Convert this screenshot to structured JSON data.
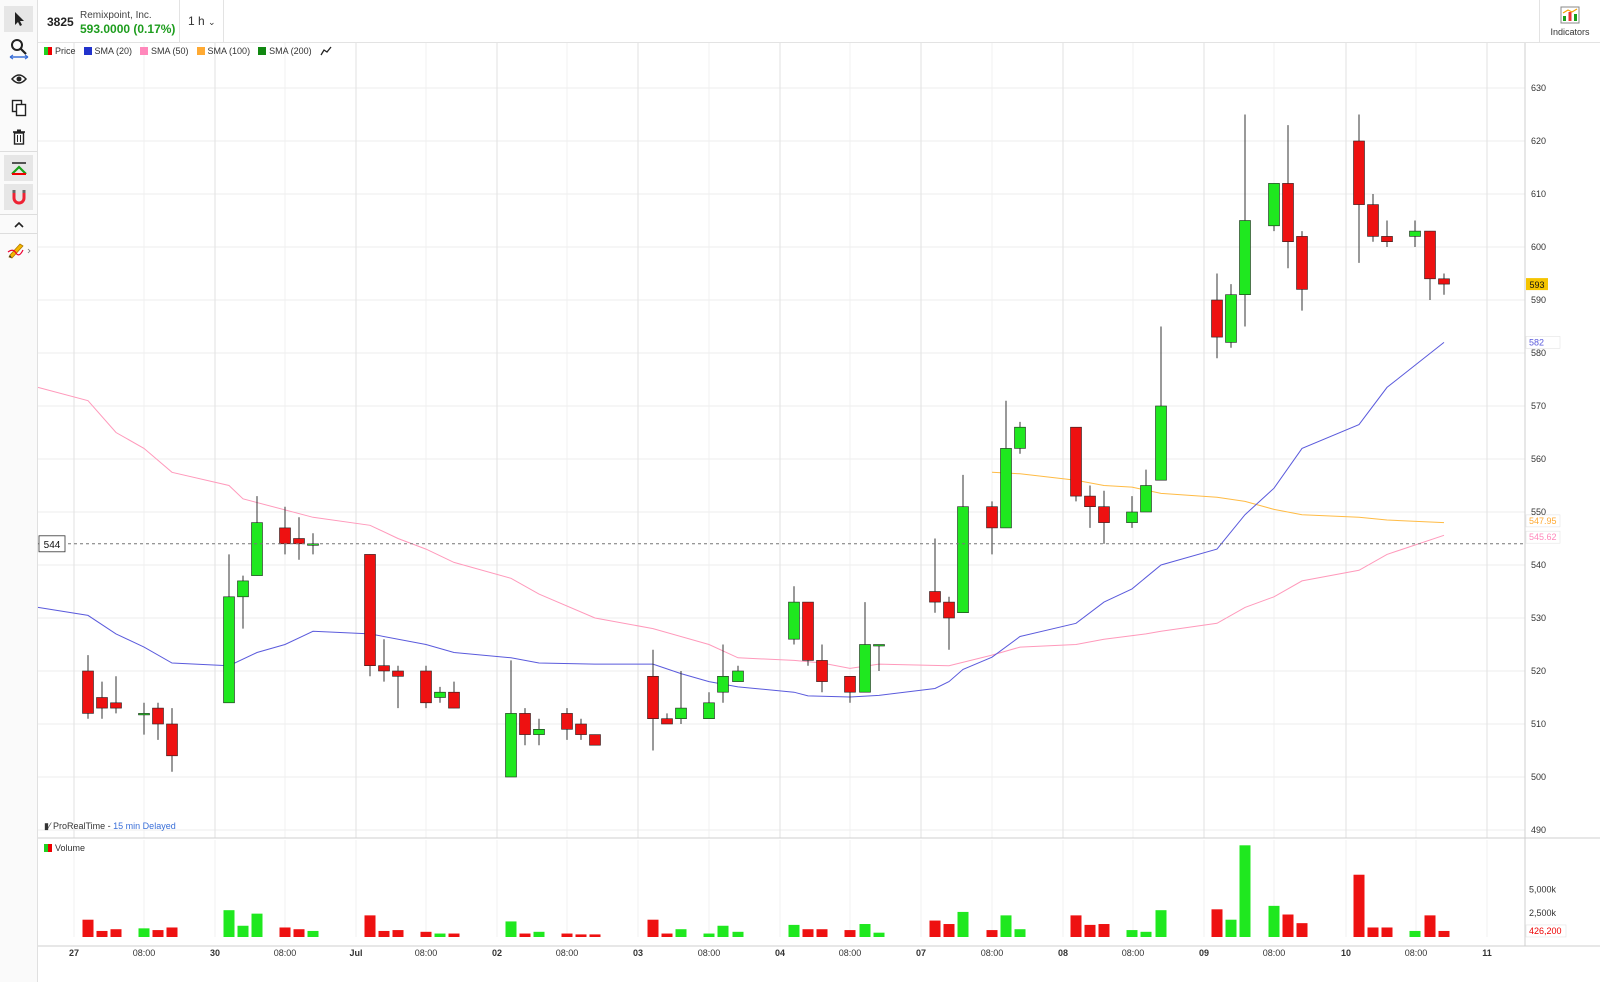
{
  "header": {
    "symbol": "3825",
    "company": "Remixpoint, Inc.",
    "price": "593.0000 (0.17%)",
    "timeframe": "1 h",
    "indicators_label": "Indicators"
  },
  "toolbar": {
    "icons": [
      "pointer-icon",
      "zoom-icon",
      "eye-icon",
      "copy-icon",
      "trash-icon",
      "trend-icon",
      "magnet-icon",
      "chevron-up-icon",
      "pencil-icon"
    ]
  },
  "legend": [
    {
      "label": "Price",
      "color": "#1fd11f"
    },
    {
      "label": "SMA (20)",
      "color": "#2233cc"
    },
    {
      "label": "SMA (50)",
      "color": "#ff88bb"
    },
    {
      "label": "SMA (100)",
      "color": "#ffaa33"
    },
    {
      "label": "SMA (200)",
      "color": "#118811"
    }
  ],
  "footer": {
    "source": "ProRealTime",
    "delay": "15 min Delayed"
  },
  "volume_label": "Volume",
  "crosshair_label": "544",
  "colors": {
    "up": "#1fe81f",
    "down": "#ee1111",
    "sma20": "#5a5adc",
    "sma50": "#ff99bb",
    "sma100": "#ffbb44"
  },
  "chart_data": {
    "type": "candlestick",
    "price_axis": {
      "ticks": [
        490,
        500,
        510,
        520,
        530,
        540,
        550,
        560,
        570,
        580,
        590,
        600,
        610,
        620,
        630
      ]
    },
    "volume_axis": {
      "ticks": [
        "2,500k",
        "5,000k"
      ]
    },
    "time_axis": {
      "labels": [
        "27",
        "08:00",
        "30",
        "08:00",
        "Jul",
        "08:00",
        "02",
        "08:00",
        "03",
        "08:00",
        "04",
        "08:00",
        "07",
        "08:00",
        "08",
        "08:00",
        "09",
        "08:00",
        "10",
        "08:00",
        "11"
      ]
    },
    "current_price_label": "593",
    "sma_labels": [
      {
        "text": "582",
        "color": "#5a5adc"
      },
      {
        "text": "547.95",
        "color": "#ffaa33"
      },
      {
        "text": "545.62",
        "color": "#ff88bb"
      }
    ],
    "volume_last_label": "426,200",
    "candles": [
      [
        88,
        520,
        512,
        523,
        511
      ],
      [
        102,
        515,
        513,
        518,
        511
      ],
      [
        116,
        514,
        513,
        519,
        512
      ],
      [
        144,
        512,
        512,
        514,
        508
      ],
      [
        158,
        513,
        510,
        514,
        507
      ],
      [
        172,
        510,
        504,
        513,
        501
      ],
      [
        229,
        514,
        534,
        542,
        514
      ],
      [
        243,
        534,
        537,
        538,
        528
      ],
      [
        257,
        538,
        548,
        553,
        538
      ],
      [
        285,
        547,
        544,
        551,
        542
      ],
      [
        299,
        545,
        544,
        549,
        541
      ],
      [
        313,
        544,
        544,
        546,
        542
      ],
      [
        370,
        542,
        521,
        542,
        519
      ],
      [
        384,
        521,
        520,
        526,
        518
      ],
      [
        398,
        520,
        519,
        521,
        513
      ],
      [
        426,
        520,
        514,
        521,
        513
      ],
      [
        440,
        515,
        516,
        517,
        514
      ],
      [
        454,
        516,
        513,
        518,
        513
      ],
      [
        511,
        500,
        512,
        522,
        500
      ],
      [
        525,
        512,
        508,
        513,
        506
      ],
      [
        539,
        508,
        509,
        511,
        506
      ],
      [
        567,
        512,
        509,
        513,
        507
      ],
      [
        581,
        510,
        508,
        511,
        507
      ],
      [
        595,
        508,
        506,
        508,
        506
      ],
      [
        653,
        519,
        511,
        524,
        505
      ],
      [
        667,
        511,
        510,
        512,
        510
      ],
      [
        681,
        511,
        513,
        520,
        510
      ],
      [
        709,
        511,
        514,
        516,
        512
      ],
      [
        723,
        516,
        519,
        525,
        514
      ],
      [
        738,
        518,
        520,
        521,
        518
      ],
      [
        794,
        526,
        533,
        536,
        525
      ],
      [
        808,
        533,
        522,
        533,
        521
      ],
      [
        822,
        522,
        518,
        525,
        516
      ],
      [
        850,
        519,
        516,
        519,
        514
      ],
      [
        865,
        516,
        525,
        533,
        516
      ],
      [
        879,
        525,
        525,
        525,
        520
      ],
      [
        935,
        535,
        533,
        545,
        531
      ],
      [
        949,
        533,
        530,
        534,
        524
      ],
      [
        963,
        531,
        551,
        557,
        531
      ],
      [
        992,
        551,
        547,
        552,
        542
      ],
      [
        1006,
        547,
        562,
        571,
        547
      ],
      [
        1020,
        562,
        566,
        567,
        561
      ],
      [
        1076,
        566,
        553,
        566,
        552
      ],
      [
        1090,
        553,
        551,
        555,
        547
      ],
      [
        1104,
        551,
        548,
        554,
        544
      ],
      [
        1132,
        548,
        550,
        553,
        547
      ],
      [
        1146,
        550,
        555,
        558,
        550
      ],
      [
        1161,
        556,
        570,
        585,
        556
      ],
      [
        1217,
        590,
        583,
        595,
        579
      ],
      [
        1231,
        582,
        591,
        593,
        581
      ],
      [
        1245,
        591,
        605,
        625,
        585
      ],
      [
        1274,
        604,
        612,
        612,
        603
      ],
      [
        1288,
        612,
        601,
        623,
        596
      ],
      [
        1302,
        602,
        592,
        603,
        588
      ],
      [
        1359,
        620,
        608,
        625,
        597
      ],
      [
        1373,
        608,
        602,
        610,
        601
      ],
      [
        1387,
        602,
        601,
        605,
        600
      ],
      [
        1415,
        602,
        603,
        605,
        600
      ],
      [
        1430,
        603,
        594,
        603,
        590
      ],
      [
        1444,
        594,
        593,
        595,
        591
      ]
    ],
    "volumes": [
      [
        88,
        1.0
      ],
      [
        102,
        0.35
      ],
      [
        116,
        0.45
      ],
      [
        144,
        0.5
      ],
      [
        158,
        0.4
      ],
      [
        172,
        0.55
      ],
      [
        229,
        1.55
      ],
      [
        243,
        0.65
      ],
      [
        257,
        1.35
      ],
      [
        285,
        0.55
      ],
      [
        299,
        0.45
      ],
      [
        313,
        0.35
      ],
      [
        370,
        1.25
      ],
      [
        384,
        0.35
      ],
      [
        398,
        0.4
      ],
      [
        426,
        0.3
      ],
      [
        440,
        0.2
      ],
      [
        454,
        0.2
      ],
      [
        511,
        0.9
      ],
      [
        525,
        0.2
      ],
      [
        539,
        0.3
      ],
      [
        567,
        0.2
      ],
      [
        581,
        0.15
      ],
      [
        595,
        0.15
      ],
      [
        653,
        1.0
      ],
      [
        667,
        0.2
      ],
      [
        681,
        0.45
      ],
      [
        709,
        0.2
      ],
      [
        723,
        0.65
      ],
      [
        738,
        0.3
      ],
      [
        794,
        0.7
      ],
      [
        808,
        0.45
      ],
      [
        822,
        0.45
      ],
      [
        850,
        0.4
      ],
      [
        865,
        0.75
      ],
      [
        879,
        0.25
      ],
      [
        935,
        0.95
      ],
      [
        949,
        0.75
      ],
      [
        963,
        1.45
      ],
      [
        992,
        0.4
      ],
      [
        1006,
        1.25
      ],
      [
        1020,
        0.45
      ],
      [
        1076,
        1.25
      ],
      [
        1090,
        0.7
      ],
      [
        1104,
        0.75
      ],
      [
        1132,
        0.4
      ],
      [
        1146,
        0.3
      ],
      [
        1161,
        1.55
      ],
      [
        1217,
        1.6
      ],
      [
        1231,
        1.0
      ],
      [
        1245,
        5.3
      ],
      [
        1274,
        1.8
      ],
      [
        1288,
        1.3
      ],
      [
        1302,
        0.8
      ],
      [
        1359,
        3.6
      ],
      [
        1373,
        0.55
      ],
      [
        1387,
        0.55
      ],
      [
        1415,
        0.35
      ],
      [
        1430,
        1.25
      ],
      [
        1444,
        0.35
      ]
    ],
    "sma20": [
      [
        38,
        532
      ],
      [
        88,
        530.5
      ],
      [
        116,
        527
      ],
      [
        144,
        524.5
      ],
      [
        172,
        521.5
      ],
      [
        229,
        521
      ],
      [
        257,
        523.5
      ],
      [
        285,
        525
      ],
      [
        313,
        527.5
      ],
      [
        370,
        527
      ],
      [
        426,
        525
      ],
      [
        454,
        523.5
      ],
      [
        511,
        522.5
      ],
      [
        539,
        521.5
      ],
      [
        595,
        521.3
      ],
      [
        653,
        521.3
      ],
      [
        681,
        519.5
      ],
      [
        709,
        518
      ],
      [
        738,
        517
      ],
      [
        794,
        516
      ],
      [
        808,
        515.3
      ],
      [
        850,
        515.1
      ],
      [
        879,
        515.4
      ],
      [
        935,
        516.7
      ],
      [
        949,
        518
      ],
      [
        963,
        520.3
      ],
      [
        992,
        522.6
      ],
      [
        1020,
        526.5
      ],
      [
        1076,
        529
      ],
      [
        1104,
        533
      ],
      [
        1132,
        535.5
      ],
      [
        1161,
        540
      ],
      [
        1217,
        543
      ],
      [
        1245,
        549.5
      ],
      [
        1274,
        554.5
      ],
      [
        1302,
        562
      ],
      [
        1359,
        566.5
      ],
      [
        1387,
        573.5
      ],
      [
        1444,
        582
      ]
    ],
    "sma50": [
      [
        38,
        573.5
      ],
      [
        88,
        571
      ],
      [
        116,
        565
      ],
      [
        144,
        562
      ],
      [
        172,
        557.5
      ],
      [
        229,
        555
      ],
      [
        243,
        552.5
      ],
      [
        313,
        549
      ],
      [
        370,
        547.5
      ],
      [
        398,
        545
      ],
      [
        426,
        543
      ],
      [
        454,
        540.5
      ],
      [
        511,
        537.5
      ],
      [
        539,
        534.5
      ],
      [
        595,
        530
      ],
      [
        653,
        528
      ],
      [
        709,
        525
      ],
      [
        738,
        522.5
      ],
      [
        794,
        522
      ],
      [
        822,
        521.5
      ],
      [
        850,
        520.5
      ],
      [
        879,
        521.3
      ],
      [
        949,
        521
      ],
      [
        992,
        523
      ],
      [
        1020,
        524.5
      ],
      [
        1076,
        525
      ],
      [
        1104,
        526
      ],
      [
        1146,
        527
      ],
      [
        1161,
        527.5
      ],
      [
        1217,
        529
      ],
      [
        1245,
        532
      ],
      [
        1274,
        534
      ],
      [
        1302,
        537
      ],
      [
        1359,
        539
      ],
      [
        1387,
        542
      ],
      [
        1444,
        545.6
      ]
    ],
    "sma100": [
      [
        992,
        557.5
      ],
      [
        1020,
        557.2
      ],
      [
        1076,
        556
      ],
      [
        1104,
        555
      ],
      [
        1132,
        554.7
      ],
      [
        1161,
        553.5
      ],
      [
        1217,
        552.8
      ],
      [
        1245,
        552
      ],
      [
        1274,
        550.5
      ],
      [
        1302,
        549.5
      ],
      [
        1359,
        549
      ],
      [
        1387,
        548.5
      ],
      [
        1444,
        548
      ]
    ]
  }
}
